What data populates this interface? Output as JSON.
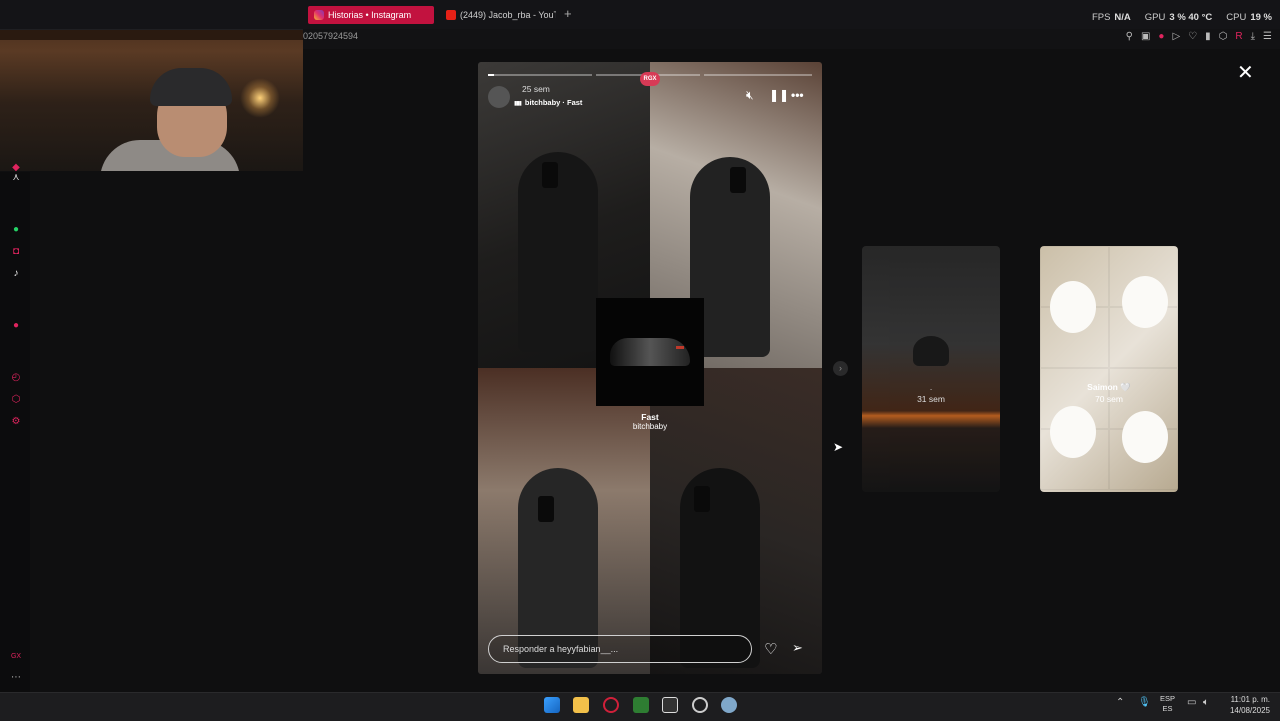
{
  "browser": {
    "tabs": [
      {
        "title": "Historias • Instagram",
        "active": true
      },
      {
        "title": "(2449) Jacob_rba - YouTu",
        "active": false
      }
    ],
    "new_tab": "+",
    "url_fragment": "02057924594"
  },
  "hud": {
    "fps_label": "FPS",
    "fps_value": "N/A",
    "gpu_label": "GPU",
    "gpu_value": "3 %  40 °C",
    "cpu_label": "CPU",
    "cpu_value": "19 %"
  },
  "story": {
    "time": "25 sem",
    "song": "bitchbaby · Fast",
    "badge": "RGX",
    "sticker_title": "Fast",
    "sticker_artist": "bitchbaby",
    "reply_placeholder": "Responder a heyyfabian__...",
    "progress": 0.02
  },
  "previews": [
    {
      "dot": ".",
      "time": "31 sem"
    },
    {
      "name": "Saimon 🤍",
      "time": "70 sem"
    }
  ],
  "taskbar": {
    "lang_top": "ESP",
    "lang_bottom": "ES",
    "time": "11:01 p. m.",
    "date": "14/08/2025"
  },
  "colors": {
    "accent": "#c2123f",
    "background": "#0f0f10"
  }
}
